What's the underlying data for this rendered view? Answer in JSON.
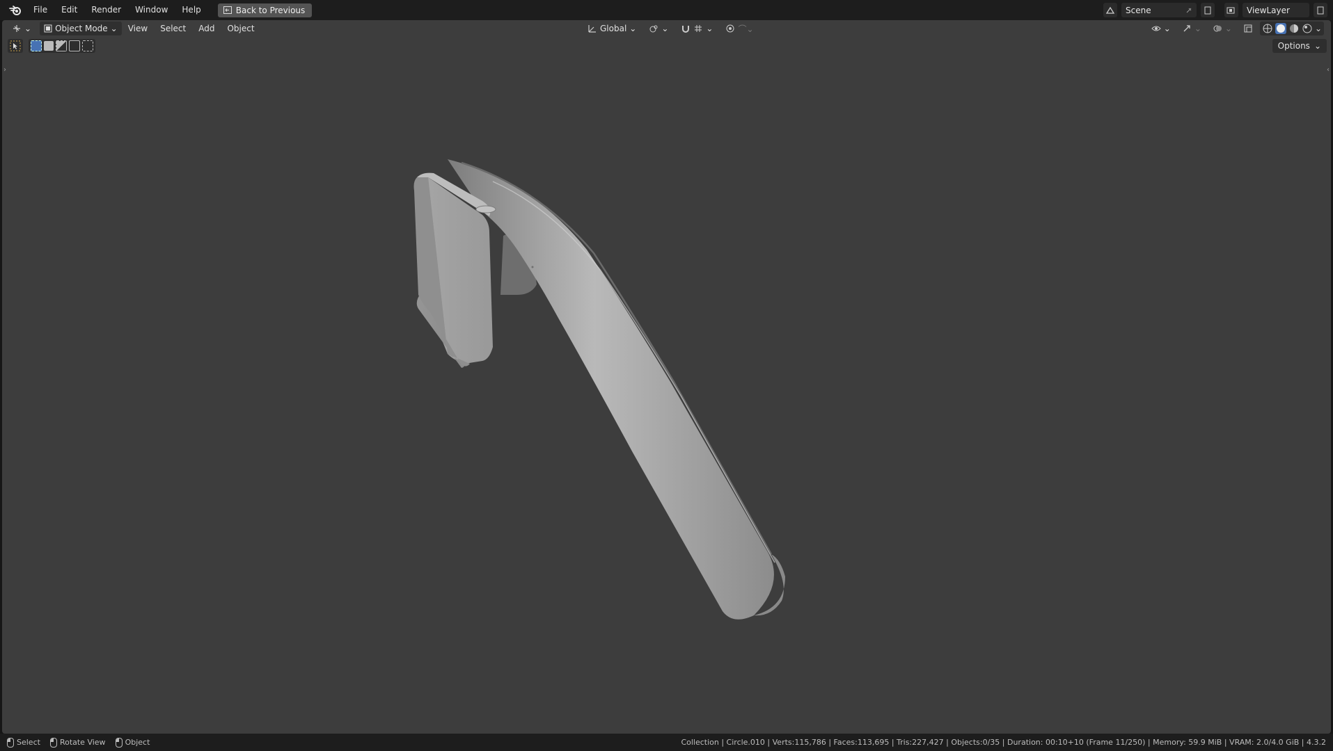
{
  "topbar": {
    "menu": [
      "File",
      "Edit",
      "Render",
      "Window",
      "Help"
    ],
    "back_button": "Back to Previous",
    "scene_name": "Scene",
    "view_layer": "ViewLayer"
  },
  "viewport_header": {
    "mode": "Object Mode",
    "menus": [
      "View",
      "Select",
      "Add",
      "Object"
    ],
    "transform_orientation": "Global",
    "options_label": "Options"
  },
  "statusbar": {
    "hints": [
      "Select",
      "Rotate View",
      "Object"
    ],
    "info": "Collection | Circle.010 | Verts:115,786 | Faces:113,695 | Tris:227,427 | Objects:0/35 | Duration: 00:10+10 (Frame 11/250) | Memory: 59.9 MiB | VRAM: 2.0/4.0 GiB | 4.3.2"
  },
  "icons": {
    "logo": "blender-logo-icon",
    "editor_type": "3d-viewport-icon",
    "shading_active": "solid-shading-icon"
  },
  "colors": {
    "viewport_bg": "#3d3d3d",
    "ui_bg": "#1d1d1d",
    "accent": "#4772b3",
    "model": "#a9a9a9"
  }
}
